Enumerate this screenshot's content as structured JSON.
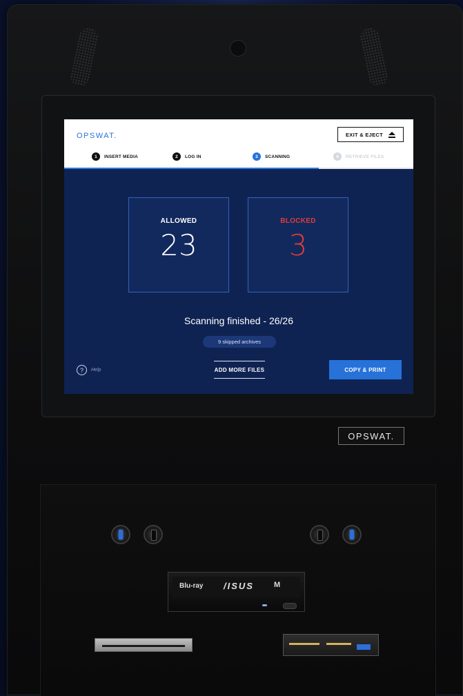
{
  "header": {
    "logo": "OPSWAT.",
    "exit_button": "EXIT & EJECT",
    "exit_icon": "eject-icon"
  },
  "steps": [
    {
      "num": "1",
      "label": "INSERT MEDIA",
      "state": "done"
    },
    {
      "num": "2",
      "label": "LOG IN",
      "state": "done"
    },
    {
      "num": "3",
      "label": "SCANNING",
      "state": "active"
    },
    {
      "num": "4",
      "label": "RETRIEVE FILES",
      "state": "disabled"
    }
  ],
  "progress": {
    "fraction": 0.73
  },
  "results": {
    "allowed": {
      "label": "ALLOWED",
      "value": "23"
    },
    "blocked": {
      "label": "BLOCKED",
      "value": "3",
      "color": "#e23b3b"
    }
  },
  "status": {
    "text": "Scanning finished - 26/26",
    "skipped": "9 skipped archives"
  },
  "footer": {
    "help_icon": "?",
    "help_label": "Help",
    "add_files": "ADD MORE FILES",
    "copy_print": "COPY & PRINT"
  },
  "hardware": {
    "badge": "OPSWAT.",
    "bluray_logo": "Blu-ray",
    "bluray_brand": "/ISUS",
    "bluray_mdisc": "M"
  },
  "colors": {
    "accent": "#2672d9",
    "screen_bg": "#0f2353",
    "blocked": "#e23b3b"
  }
}
